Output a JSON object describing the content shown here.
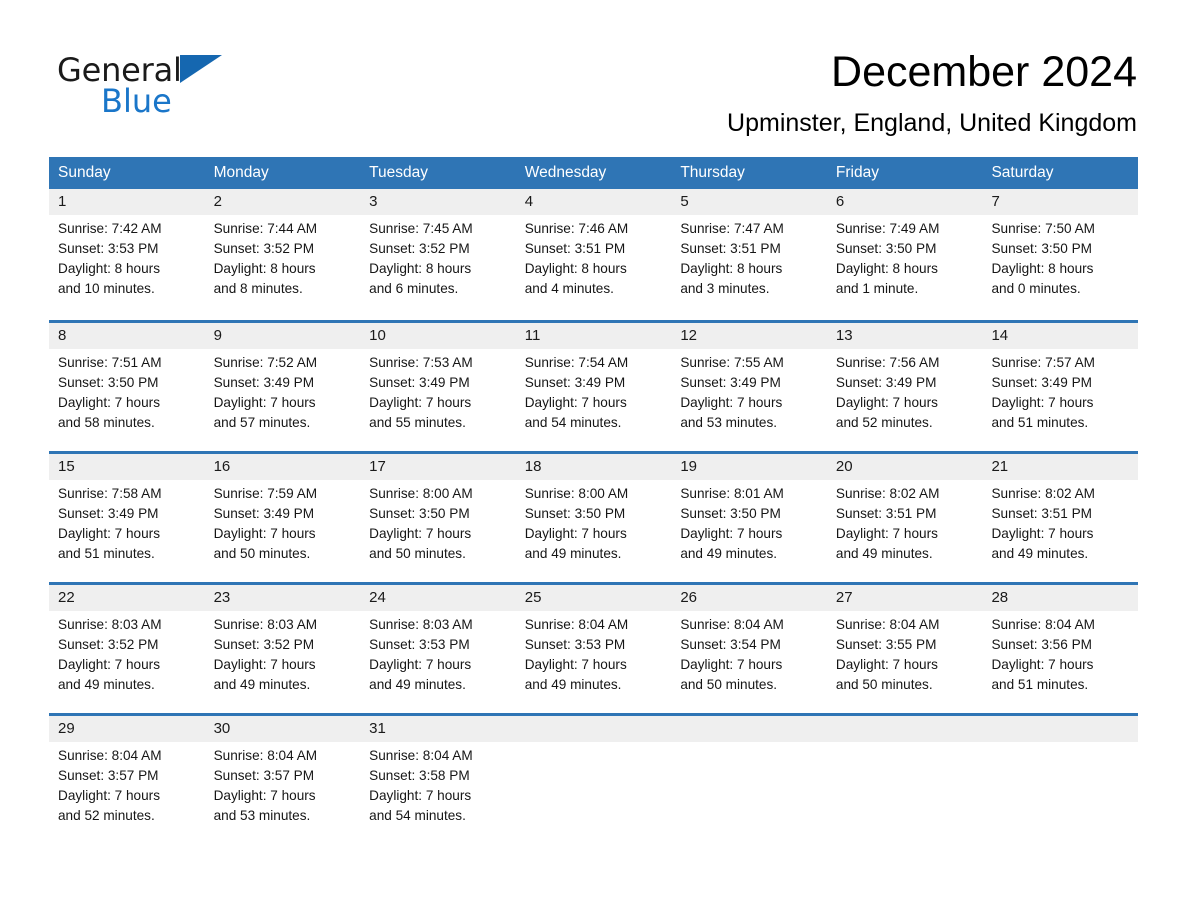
{
  "brand": {
    "name_part1": "General",
    "name_part2": "Blue",
    "triangle_color": "#1567b0",
    "blue_color": "#1a76c9"
  },
  "header": {
    "title": "December 2024",
    "subtitle": "Upminster, England, United Kingdom"
  },
  "theme": {
    "header_blue": "#2f75b5",
    "row_rule_blue": "#2f75b5",
    "daynum_band": "#efefef"
  },
  "weekdays": [
    "Sunday",
    "Monday",
    "Tuesday",
    "Wednesday",
    "Thursday",
    "Friday",
    "Saturday"
  ],
  "weeks": [
    [
      {
        "day": "1",
        "info": "Sunrise: 7:42 AM\nSunset: 3:53 PM\nDaylight: 8 hours\nand 10 minutes."
      },
      {
        "day": "2",
        "info": "Sunrise: 7:44 AM\nSunset: 3:52 PM\nDaylight: 8 hours\nand 8 minutes."
      },
      {
        "day": "3",
        "info": "Sunrise: 7:45 AM\nSunset: 3:52 PM\nDaylight: 8 hours\nand 6 minutes."
      },
      {
        "day": "4",
        "info": "Sunrise: 7:46 AM\nSunset: 3:51 PM\nDaylight: 8 hours\nand 4 minutes."
      },
      {
        "day": "5",
        "info": "Sunrise: 7:47 AM\nSunset: 3:51 PM\nDaylight: 8 hours\nand 3 minutes."
      },
      {
        "day": "6",
        "info": "Sunrise: 7:49 AM\nSunset: 3:50 PM\nDaylight: 8 hours\nand 1 minute."
      },
      {
        "day": "7",
        "info": "Sunrise: 7:50 AM\nSunset: 3:50 PM\nDaylight: 8 hours\nand 0 minutes."
      }
    ],
    [
      {
        "day": "8",
        "info": "Sunrise: 7:51 AM\nSunset: 3:50 PM\nDaylight: 7 hours\nand 58 minutes."
      },
      {
        "day": "9",
        "info": "Sunrise: 7:52 AM\nSunset: 3:49 PM\nDaylight: 7 hours\nand 57 minutes."
      },
      {
        "day": "10",
        "info": "Sunrise: 7:53 AM\nSunset: 3:49 PM\nDaylight: 7 hours\nand 55 minutes."
      },
      {
        "day": "11",
        "info": "Sunrise: 7:54 AM\nSunset: 3:49 PM\nDaylight: 7 hours\nand 54 minutes."
      },
      {
        "day": "12",
        "info": "Sunrise: 7:55 AM\nSunset: 3:49 PM\nDaylight: 7 hours\nand 53 minutes."
      },
      {
        "day": "13",
        "info": "Sunrise: 7:56 AM\nSunset: 3:49 PM\nDaylight: 7 hours\nand 52 minutes."
      },
      {
        "day": "14",
        "info": "Sunrise: 7:57 AM\nSunset: 3:49 PM\nDaylight: 7 hours\nand 51 minutes."
      }
    ],
    [
      {
        "day": "15",
        "info": "Sunrise: 7:58 AM\nSunset: 3:49 PM\nDaylight: 7 hours\nand 51 minutes."
      },
      {
        "day": "16",
        "info": "Sunrise: 7:59 AM\nSunset: 3:49 PM\nDaylight: 7 hours\nand 50 minutes."
      },
      {
        "day": "17",
        "info": "Sunrise: 8:00 AM\nSunset: 3:50 PM\nDaylight: 7 hours\nand 50 minutes."
      },
      {
        "day": "18",
        "info": "Sunrise: 8:00 AM\nSunset: 3:50 PM\nDaylight: 7 hours\nand 49 minutes."
      },
      {
        "day": "19",
        "info": "Sunrise: 8:01 AM\nSunset: 3:50 PM\nDaylight: 7 hours\nand 49 minutes."
      },
      {
        "day": "20",
        "info": "Sunrise: 8:02 AM\nSunset: 3:51 PM\nDaylight: 7 hours\nand 49 minutes."
      },
      {
        "day": "21",
        "info": "Sunrise: 8:02 AM\nSunset: 3:51 PM\nDaylight: 7 hours\nand 49 minutes."
      }
    ],
    [
      {
        "day": "22",
        "info": "Sunrise: 8:03 AM\nSunset: 3:52 PM\nDaylight: 7 hours\nand 49 minutes."
      },
      {
        "day": "23",
        "info": "Sunrise: 8:03 AM\nSunset: 3:52 PM\nDaylight: 7 hours\nand 49 minutes."
      },
      {
        "day": "24",
        "info": "Sunrise: 8:03 AM\nSunset: 3:53 PM\nDaylight: 7 hours\nand 49 minutes."
      },
      {
        "day": "25",
        "info": "Sunrise: 8:04 AM\nSunset: 3:53 PM\nDaylight: 7 hours\nand 49 minutes."
      },
      {
        "day": "26",
        "info": "Sunrise: 8:04 AM\nSunset: 3:54 PM\nDaylight: 7 hours\nand 50 minutes."
      },
      {
        "day": "27",
        "info": "Sunrise: 8:04 AM\nSunset: 3:55 PM\nDaylight: 7 hours\nand 50 minutes."
      },
      {
        "day": "28",
        "info": "Sunrise: 8:04 AM\nSunset: 3:56 PM\nDaylight: 7 hours\nand 51 minutes."
      }
    ],
    [
      {
        "day": "29",
        "info": "Sunrise: 8:04 AM\nSunset: 3:57 PM\nDaylight: 7 hours\nand 52 minutes."
      },
      {
        "day": "30",
        "info": "Sunrise: 8:04 AM\nSunset: 3:57 PM\nDaylight: 7 hours\nand 53 minutes."
      },
      {
        "day": "31",
        "info": "Sunrise: 8:04 AM\nSunset: 3:58 PM\nDaylight: 7 hours\nand 54 minutes."
      },
      {
        "day": "",
        "info": ""
      },
      {
        "day": "",
        "info": ""
      },
      {
        "day": "",
        "info": ""
      },
      {
        "day": "",
        "info": ""
      }
    ]
  ]
}
